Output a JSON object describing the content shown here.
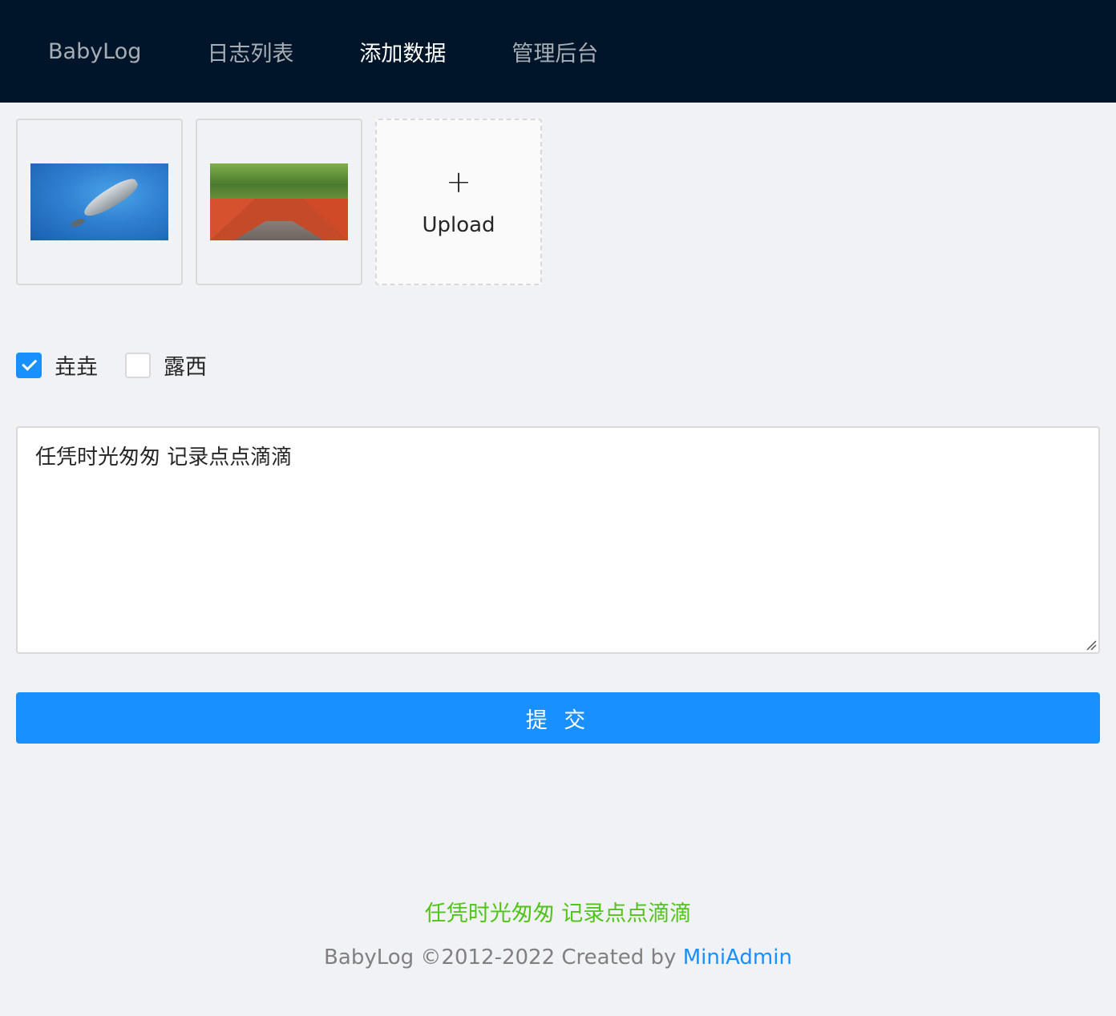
{
  "header": {
    "nav": [
      {
        "label": "BabyLog"
      },
      {
        "label": "日志列表"
      },
      {
        "label": "添加数据",
        "active": true
      },
      {
        "label": "管理后台"
      }
    ]
  },
  "upload": {
    "label": "Upload",
    "icon": "plus-icon",
    "thumbnails": [
      "whale photo",
      "red wall corridor photo"
    ]
  },
  "people": [
    {
      "label": "垚垚",
      "checked": true
    },
    {
      "label": "露西",
      "checked": false
    }
  ],
  "note": {
    "value": "任凭时光匆匆 记录点点滴滴"
  },
  "submit": {
    "label": "提 交"
  },
  "footer": {
    "slogan": "任凭时光匆匆 记录点点滴滴",
    "copyright": "BabyLog ©2012-2022 Created by ",
    "link": "MiniAdmin"
  },
  "colors": {
    "header_bg": "#001529",
    "primary": "#1890ff",
    "slogan": "#52c41a",
    "page_bg": "#f0f2f5"
  }
}
